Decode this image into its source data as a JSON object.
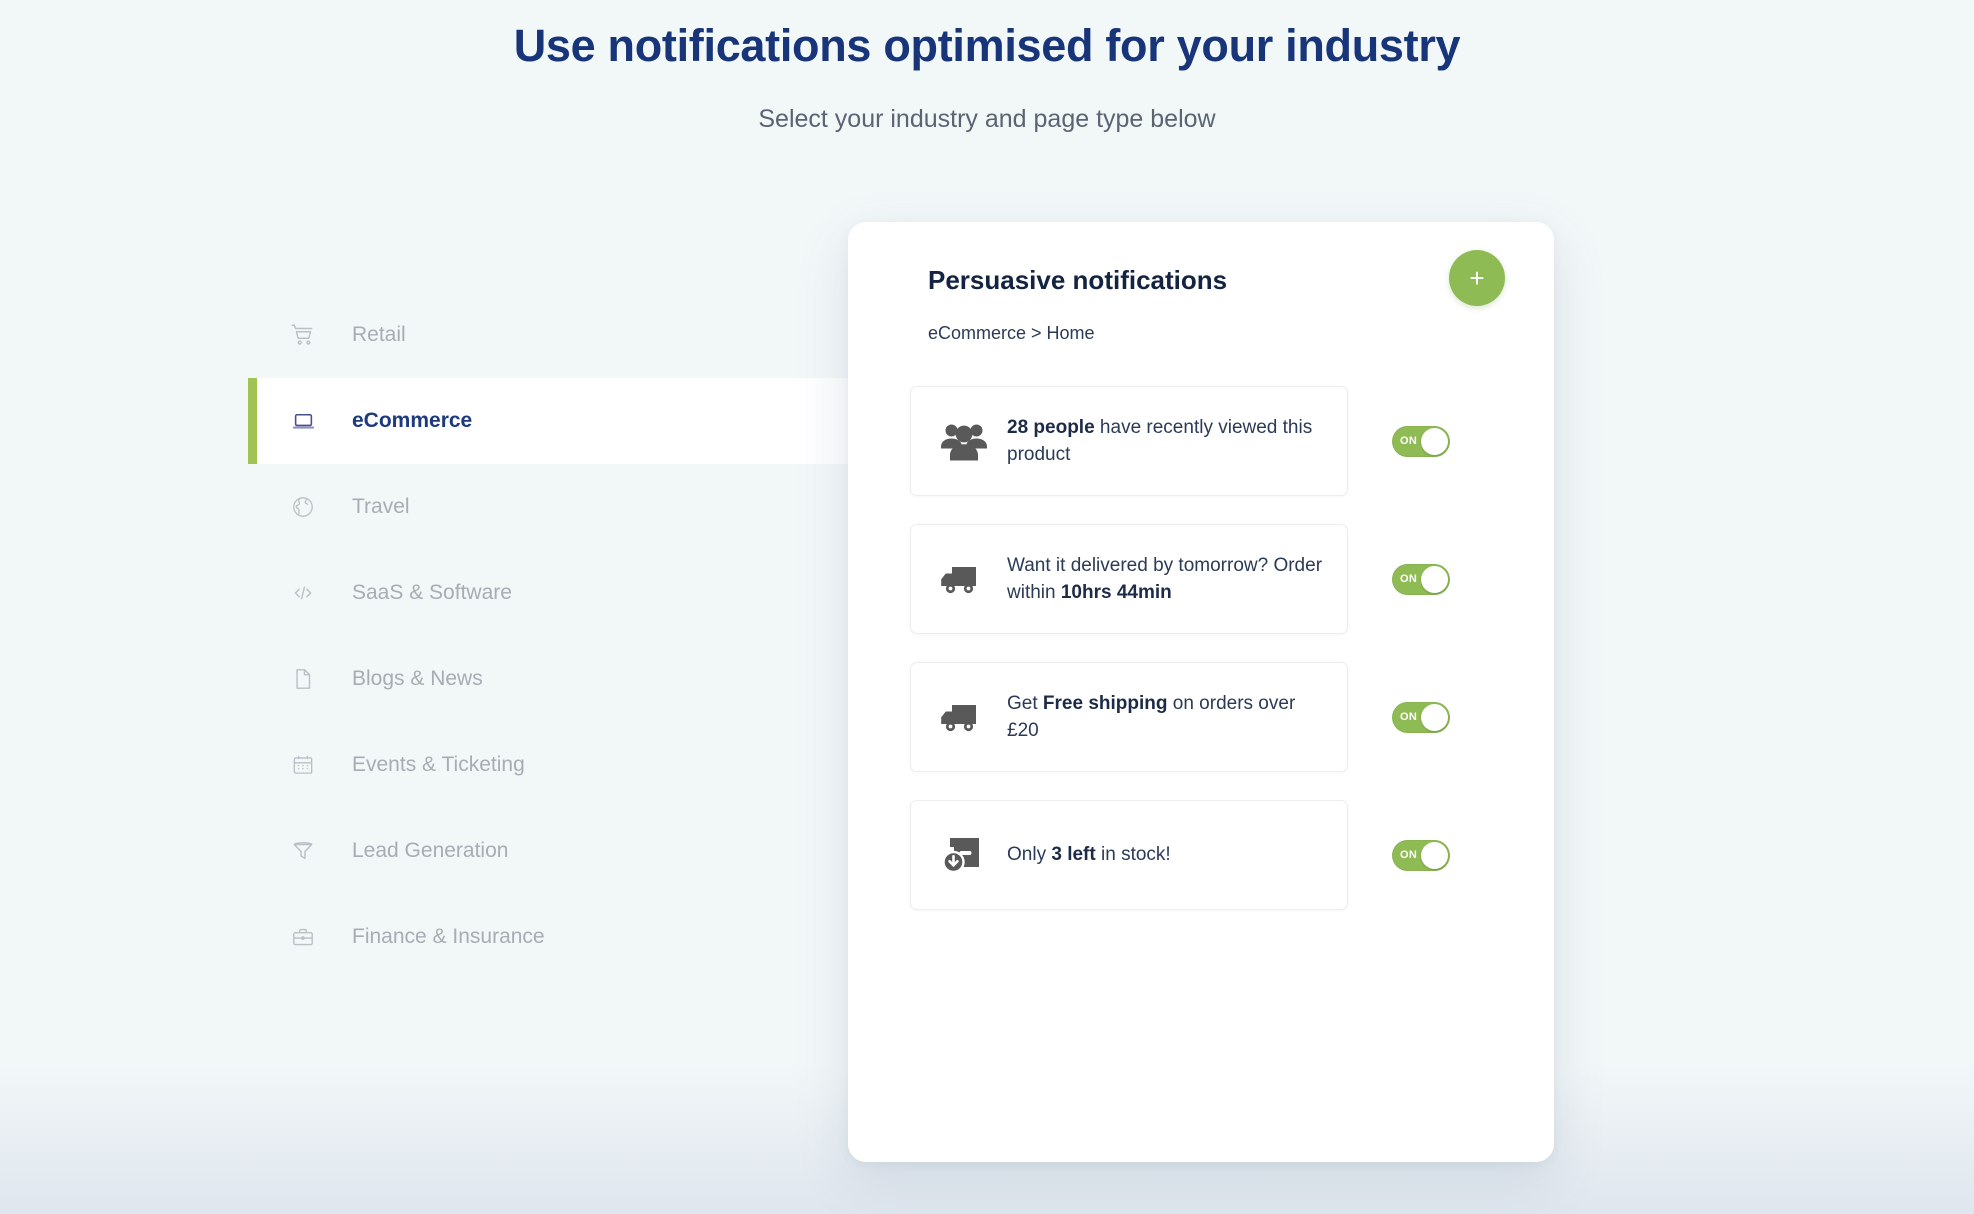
{
  "header": {
    "title": "Use notifications optimised for your industry",
    "subtitle": "Select your industry and page type below"
  },
  "colors": {
    "page_background": "#f2f7f8",
    "heading": "#18357a",
    "accent_green": "#a0c353",
    "toggle_green": "#8fbb55",
    "card_background": "#ffffff",
    "muted_text": "#a6adb4",
    "body_text": "#2b3a56",
    "icon_grey": "#595959"
  },
  "sidebar": {
    "items": [
      {
        "label": "Retail",
        "icon": "shopping-cart-icon",
        "active": false
      },
      {
        "label": "eCommerce",
        "icon": "laptop-icon",
        "active": true
      },
      {
        "label": "Travel",
        "icon": "globe-icon",
        "active": false
      },
      {
        "label": "SaaS & Software",
        "icon": "code-brackets-icon",
        "active": false
      },
      {
        "label": "Blogs & News",
        "icon": "document-icon",
        "active": false
      },
      {
        "label": "Events & Ticketing",
        "icon": "calendar-icon",
        "active": false
      },
      {
        "label": "Lead Generation",
        "icon": "funnel-icon",
        "active": false
      },
      {
        "label": "Finance & Insurance",
        "icon": "briefcase-icon",
        "active": false
      }
    ]
  },
  "card": {
    "title": "Persuasive notifications",
    "breadcrumb": "eCommerce > Home",
    "add_button_label": "+",
    "add_button_icon": "plus-icon",
    "notifications": [
      {
        "icon": "people-group-icon",
        "text_parts": [
          {
            "text": "28 people",
            "bold": true
          },
          {
            "text": " have recently viewed this product",
            "bold": false
          }
        ],
        "plain_text": "28 people have recently viewed this product",
        "toggle_state": "ON"
      },
      {
        "icon": "delivery-truck-icon",
        "text_parts": [
          {
            "text": "Want it delivered by tomorrow? Order within ",
            "bold": false
          },
          {
            "text": "10hrs 44min",
            "bold": true
          }
        ],
        "plain_text": "Want it delivered by tomorrow? Order within 10hrs 44min",
        "toggle_state": "ON"
      },
      {
        "icon": "delivery-truck-icon",
        "text_parts": [
          {
            "text": "Get ",
            "bold": false
          },
          {
            "text": "Free shipping",
            "bold": true
          },
          {
            "text": " on orders over £20",
            "bold": false
          }
        ],
        "plain_text": "Get Free shipping on orders over £20",
        "toggle_state": "ON"
      },
      {
        "icon": "box-download-icon",
        "text_parts": [
          {
            "text": "Only ",
            "bold": false
          },
          {
            "text": "3 left",
            "bold": true
          },
          {
            "text": " in stock!",
            "bold": false
          }
        ],
        "plain_text": "Only 3 left in stock!",
        "toggle_state": "ON"
      }
    ]
  }
}
